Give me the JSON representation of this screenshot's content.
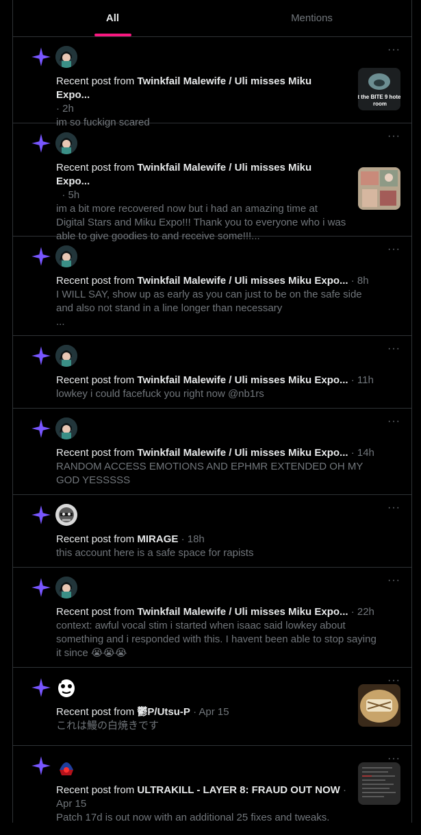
{
  "tabs": [
    {
      "label": "All",
      "active": true
    },
    {
      "label": "Mentions",
      "active": false
    }
  ],
  "colors": {
    "accent": "#f91880",
    "star": "#7856ff",
    "background": "#000000",
    "border": "#2f3336",
    "muted": "#71767b"
  },
  "prefix": "Recent post from",
  "dot": "·",
  "items": [
    {
      "author": "Twinkfail Malewife / Uli misses Miku Expo...",
      "time": "2h",
      "text": "im so fuckign scared",
      "thumb": "t the BITE 9 hotel room"
    },
    {
      "author": "Twinkfail Malewife / Uli misses Miku Expo...",
      "time": "5h",
      "text": "im a bit more recovered now but i had an amazing time at Digital Stars and Miku Expo!!! Thank you to everyone who i was able to give goodies to and receive some!!!..."
    },
    {
      "author": "Twinkfail Malewife / Uli misses Miku Expo...",
      "time": "8h",
      "text": "I WILL SAY, show up as early as you can just to be on the safe side and also not stand in a line longer than necessary",
      "text2": "..."
    },
    {
      "author": "Twinkfail Malewife / Uli misses Miku Expo...",
      "time": "11h",
      "text": "lowkey i could facefuck you right now @nb1rs"
    },
    {
      "author": "Twinkfail Malewife / Uli misses Miku Expo...",
      "time": "14h",
      "text": "RANDOM ACCESS EMOTIONS AND EPHMR EXTENDED OH MY GOD YESSSSS"
    },
    {
      "author": "MIRAGE",
      "time": "18h",
      "text": "this account here is a safe space for rapists"
    },
    {
      "author": "Twinkfail Malewife / Uli misses Miku Expo...",
      "time": "22h",
      "text": "context: awful vocal stim i started when isaac said lowkey about something and i responded with this. I havent been able to stop saying it since 😭😭😭"
    },
    {
      "author": "鬱P/Utsu-P",
      "time": "Apr 15",
      "text": "これは鰻の白焼きです"
    },
    {
      "author": "ULTRAKILL - LAYER 8: FRAUD OUT NOW",
      "time": "Apr 15",
      "text": "Patch 17d is out now with an additional 25 fixes and tweaks."
    }
  ]
}
